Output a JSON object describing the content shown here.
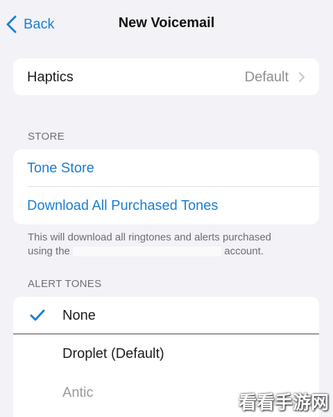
{
  "nav": {
    "back_label": "Back",
    "title": "New Voicemail"
  },
  "haptics": {
    "label": "Haptics",
    "value": "Default"
  },
  "store": {
    "header": "STORE",
    "tone_store": "Tone Store",
    "download_all": "Download All Purchased Tones",
    "footer_line1": "This will download all ringtones and alerts purchased",
    "footer_prefix": "using the",
    "footer_suffix": "account."
  },
  "alert_tones": {
    "header": "ALERT TONES",
    "items": [
      {
        "label": "None",
        "selected": true
      },
      {
        "label": "Droplet (Default)",
        "selected": false
      },
      {
        "label": "Antic",
        "selected": false
      }
    ]
  },
  "watermark": "看看手游网",
  "colors": {
    "accent": "#1a7fd4",
    "background": "#f2f2f7",
    "secondary_text": "#8e8e93"
  }
}
